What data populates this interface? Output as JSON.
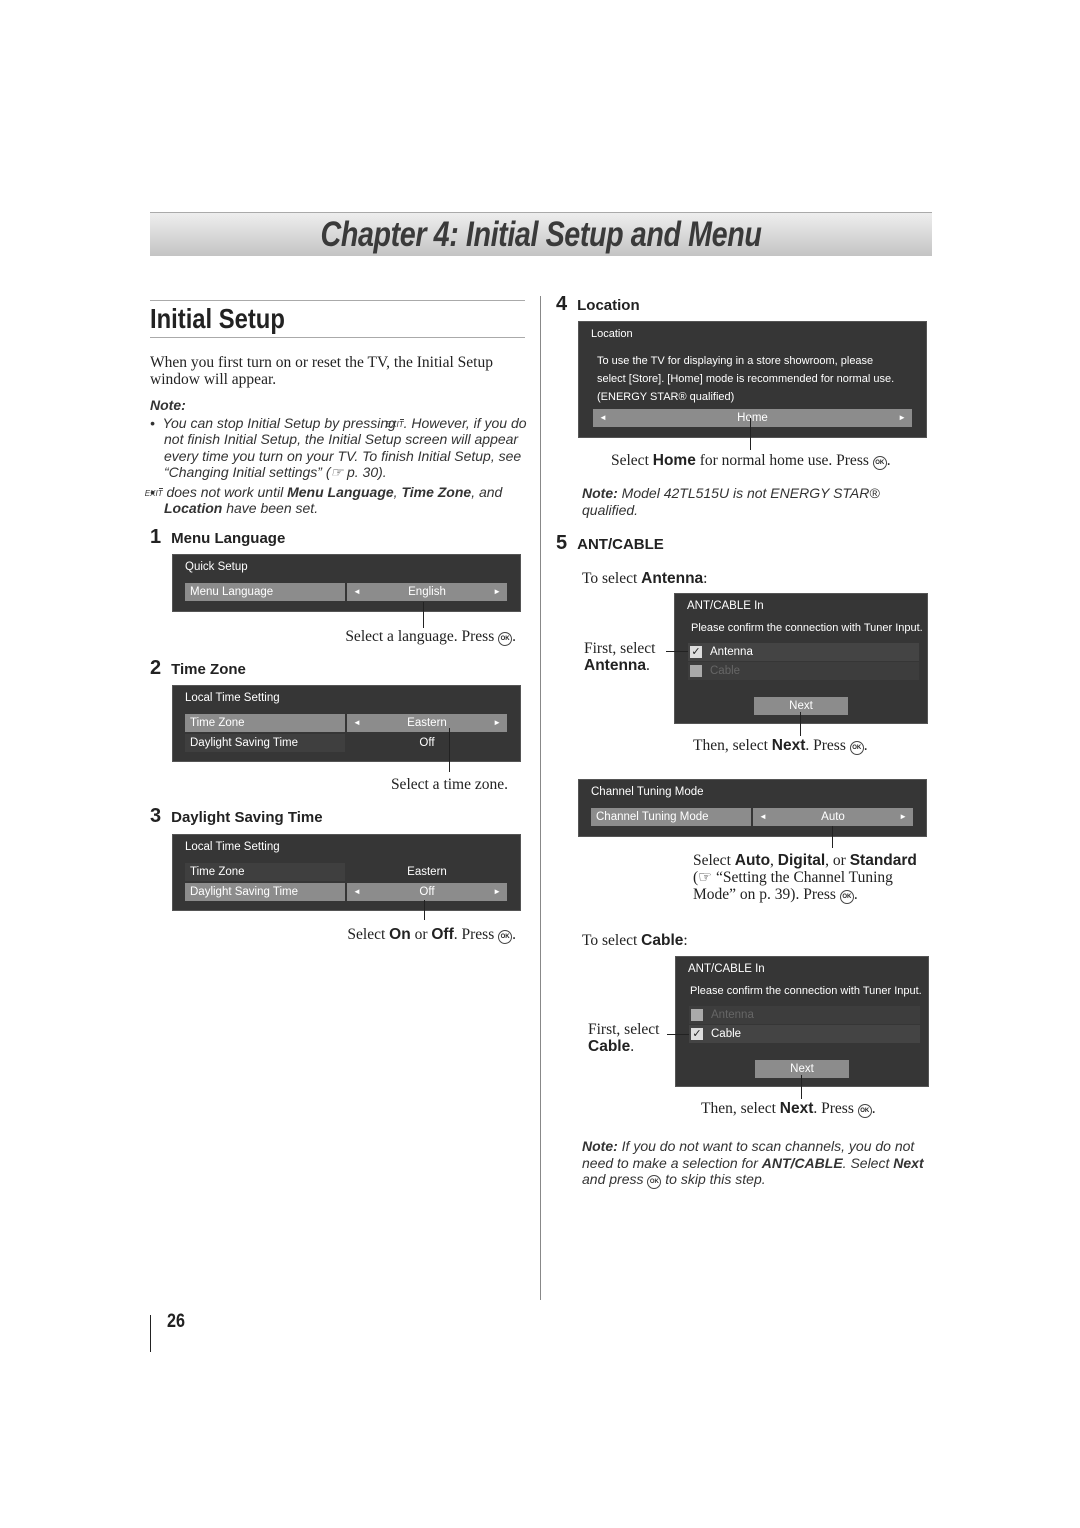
{
  "chapter_title": "Chapter 4: Initial Setup and Menu",
  "section_title": "Initial Setup",
  "intro": "When you first turn on or reset the TV, the Initial Setup window will appear.",
  "icons": {
    "exit_label": "EXIT",
    "ok_label": "OK",
    "ref": "☞"
  },
  "note": {
    "label": "Note:",
    "b1": [
      "You can stop Initial Setup by pressing ",
      ". However, if you do not finish Initial Setup, the Initial Setup screen will appear every time you turn on your TV. To finish Initial Setup, see “Changing Initial settings” (",
      "p. 30)."
    ],
    "b2": [
      " does not work until ",
      "Menu Language",
      ", ",
      "Time Zone",
      ", and ",
      "Location",
      " have been set."
    ]
  },
  "steps": [
    {
      "num": "1",
      "title": "Menu Language",
      "screen": {
        "title": "Quick Setup",
        "rows": [
          {
            "label": "Menu Language",
            "value": "English"
          }
        ]
      },
      "caption": [
        "Select a language. Press ",
        "."
      ]
    },
    {
      "num": "2",
      "title": "Time Zone",
      "screen": {
        "title": "Local Time Setting",
        "rows": [
          {
            "label": "Time Zone",
            "value": "Eastern"
          },
          {
            "label": "Daylight Saving Time",
            "value": "Off"
          }
        ]
      },
      "caption": [
        "Select a time zone."
      ]
    },
    {
      "num": "3",
      "title": "Daylight Saving Time",
      "screen": {
        "title": "Local Time Setting",
        "rows": [
          {
            "label": "Time Zone",
            "value": "Eastern"
          },
          {
            "label": "Daylight Saving Time",
            "value": "Off"
          }
        ]
      },
      "caption": [
        "Select ",
        "On",
        " or ",
        "Off",
        ". Press ",
        "."
      ]
    },
    {
      "num": "4",
      "title": "Location",
      "screen": {
        "title": "Location",
        "lines": [
          "To use the TV for displaying in a store showroom, please",
          "select [Store]. [Home] mode is recommended for normal use.",
          "(ENERGY STAR® qualified)"
        ],
        "value": "Home"
      },
      "caption": [
        "Select ",
        "Home",
        " for normal home use. Press ",
        "."
      ],
      "note": [
        "Note:",
        " Model 42TL515U is not ENERGY STAR® qualified."
      ]
    },
    {
      "num": "5",
      "title": "ANT/CABLE",
      "antenna": {
        "intro": [
          "To select ",
          "Antenna",
          ":"
        ],
        "screen": {
          "title": "ANT/CABLE In",
          "message": "Please confirm the connection with Tuner Input.",
          "options": [
            "Antenna",
            "Cable"
          ],
          "checked": "Antenna",
          "button": "Next"
        },
        "side": [
          "First, select",
          "Antenna",
          "."
        ],
        "caption": [
          "Then, select ",
          "Next",
          ". Press ",
          "."
        ]
      },
      "tuning": {
        "screen": {
          "title": "Channel Tuning Mode",
          "label": "Channel Tuning Mode",
          "value": "Auto"
        },
        "caption": [
          "Select ",
          "Auto",
          ", ",
          "Digital",
          ", or ",
          "Standard",
          "“Setting the Channel Tuning Mode” on p. 39). Press ",
          "."
        ]
      },
      "cable": {
        "intro": [
          "To select ",
          "Cable",
          ":"
        ],
        "screen": {
          "title": "ANT/CABLE In",
          "message": "Please confirm the connection with Tuner Input.",
          "options": [
            "Antenna",
            "Cable"
          ],
          "checked": "Cable",
          "button": "Next"
        },
        "side": [
          "First, select",
          "Cable",
          "."
        ],
        "caption": [
          "Then, select ",
          "Next",
          ". Press ",
          "."
        ]
      },
      "note": [
        "Note:",
        " If you do not want to scan channels, you do not need to make a selection for ",
        "ANT/CABLE",
        ". Select ",
        "Next",
        " and press ",
        " to skip this step."
      ]
    }
  ],
  "page_number": "26"
}
